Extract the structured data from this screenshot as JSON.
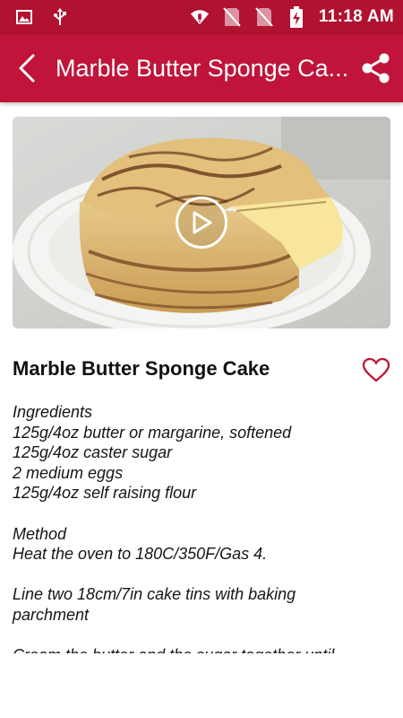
{
  "status_bar": {
    "time": "11:18 AM",
    "icons": [
      "image-icon",
      "usb-icon",
      "wifi-icon",
      "no-sim-icon",
      "no-sim-icon",
      "battery-charging-icon"
    ]
  },
  "app_bar": {
    "title": "Marble Butter Sponge Ca...",
    "back_icon": "back-arrow-icon",
    "share_icon": "share-icon"
  },
  "recipe": {
    "title": "Marble Butter Sponge Cake",
    "lines": [
      "Ingredients",
      "125g/4oz butter or margarine, softened",
      "125g/4oz caster sugar",
      "2 medium eggs",
      "125g/4oz self raising flour",
      "",
      "Method",
      "Heat the oven to 180C/350F/Gas 4.",
      "",
      "Line two 18cm/7in cake tins with baking",
      "parchment",
      "",
      "Cream the butter and the sugar together until"
    ]
  },
  "colors": {
    "status_bar": "#b0122f",
    "app_bar": "#c0143a",
    "accent": "#c0143a"
  }
}
